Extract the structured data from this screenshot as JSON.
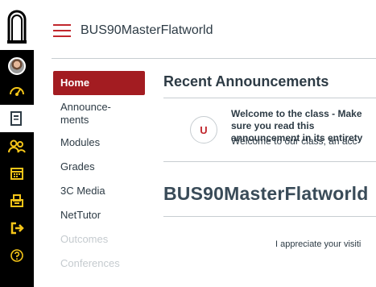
{
  "global_nav": {
    "icons": [
      {
        "name": "account-avatar-icon",
        "selected": false
      },
      {
        "name": "dashboard-icon",
        "selected": false
      },
      {
        "name": "courses-icon",
        "selected": true
      },
      {
        "name": "groups-icon",
        "selected": false
      },
      {
        "name": "calendar-icon",
        "selected": false
      },
      {
        "name": "inbox-icon",
        "selected": false
      },
      {
        "name": "logout-icon",
        "selected": false
      },
      {
        "name": "help-icon",
        "selected": false
      }
    ],
    "icon_color": "#f5c518",
    "logo_icon": "institution-arch-logo"
  },
  "header": {
    "course_title": "BUS90MasterFlatworld",
    "menu_icon": "hamburger-menu-icon",
    "accent_color": "#c1272d"
  },
  "course_nav": {
    "items": [
      {
        "label": "Home",
        "active": true,
        "enabled": true
      },
      {
        "label": "Announce-\nments",
        "active": false,
        "enabled": true
      },
      {
        "label": "Modules",
        "active": false,
        "enabled": true
      },
      {
        "label": "Grades",
        "active": false,
        "enabled": true
      },
      {
        "label": "3C Media",
        "active": false,
        "enabled": true
      },
      {
        "label": "NetTutor",
        "active": false,
        "enabled": true
      },
      {
        "label": "Outcomes",
        "active": false,
        "enabled": false
      },
      {
        "label": "Conferences",
        "active": false,
        "enabled": false
      }
    ],
    "active_color": "#a31c21"
  },
  "main": {
    "recent_heading": "Recent Announcements",
    "announcement": {
      "avatar_letter": "U",
      "title": "Welcome to the class - Make sure you read this announcement in its entirety",
      "excerpt": "Welcome to our class, an acc"
    },
    "page_title": "BUS90MasterFlatworld",
    "intro_text": "I appreciate your visiti"
  }
}
